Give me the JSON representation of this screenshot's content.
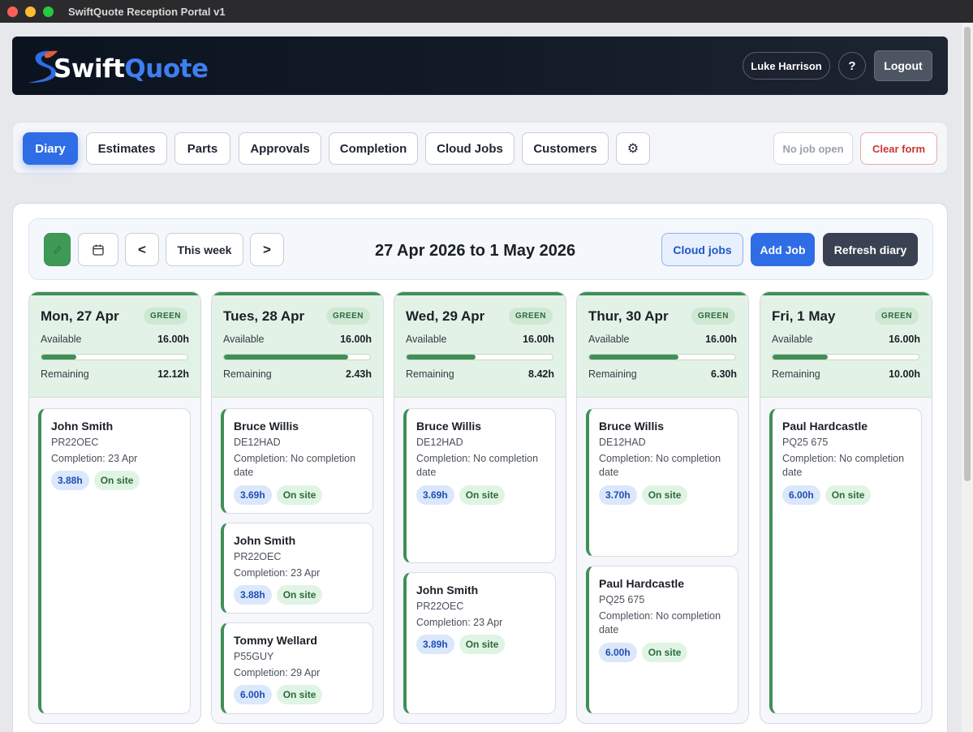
{
  "window": {
    "title": "SwiftQuote Reception Portal v1"
  },
  "header": {
    "logo_swift": "Swift",
    "logo_quote": "Quote",
    "user_name": "Luke Harrison",
    "help_label": "?",
    "logout_label": "Logout"
  },
  "nav": {
    "tabs": [
      "Diary",
      "Estimates",
      "Parts",
      "Approvals",
      "Completion",
      "Cloud Jobs",
      "Customers"
    ],
    "settings_glyph": "⚙",
    "job_status": "No job open",
    "clear_form": "Clear form"
  },
  "toolbar": {
    "prev": "<",
    "this_week": "This week",
    "next": ">",
    "range_title": "27 Apr 2026 to 1 May 2026",
    "cloud_jobs": "Cloud jobs",
    "add_job": "Add Job",
    "refresh": "Refresh diary"
  },
  "days": [
    {
      "name": "Mon, 27 Apr",
      "badge": "GREEN",
      "available_label": "Available",
      "available": "16.00h",
      "remaining_label": "Remaining",
      "remaining": "12.12h",
      "used_fraction": 0.24,
      "jobs": [
        {
          "name": "John Smith",
          "reg": "PR22OEC",
          "completion": "Completion: 23 Apr",
          "hours": "3.88h",
          "status": "On site"
        }
      ]
    },
    {
      "name": "Tues, 28 Apr",
      "badge": "GREEN",
      "available_label": "Available",
      "available": "16.00h",
      "remaining_label": "Remaining",
      "remaining": "2.43h",
      "used_fraction": 0.85,
      "jobs": [
        {
          "name": "Bruce Willis",
          "reg": "DE12HAD",
          "completion": "Completion: No completion date",
          "hours": "3.69h",
          "status": "On site"
        },
        {
          "name": "John Smith",
          "reg": "PR22OEC",
          "completion": "Completion: 23 Apr",
          "hours": "3.88h",
          "status": "On site"
        },
        {
          "name": "Tommy Wellard",
          "reg": "P55GUY",
          "completion": "Completion: 29 Apr",
          "hours": "6.00h",
          "status": "On site"
        }
      ]
    },
    {
      "name": "Wed, 29 Apr",
      "badge": "GREEN",
      "available_label": "Available",
      "available": "16.00h",
      "remaining_label": "Remaining",
      "remaining": "8.42h",
      "used_fraction": 0.47,
      "jobs": [
        {
          "name": "Bruce Willis",
          "reg": "DE12HAD",
          "completion": "Completion: No completion date",
          "hours": "3.69h",
          "status": "On site"
        },
        {
          "name": "John Smith",
          "reg": "PR22OEC",
          "completion": "Completion: 23 Apr",
          "hours": "3.89h",
          "status": "On site"
        }
      ]
    },
    {
      "name": "Thur, 30 Apr",
      "badge": "GREEN",
      "available_label": "Available",
      "available": "16.00h",
      "remaining_label": "Remaining",
      "remaining": "6.30h",
      "used_fraction": 0.61,
      "jobs": [
        {
          "name": "Bruce Willis",
          "reg": "DE12HAD",
          "completion": "Completion: No completion date",
          "hours": "3.70h",
          "status": "On site"
        },
        {
          "name": "Paul Hardcastle",
          "reg": "PQ25 675",
          "completion": "Completion: No completion date",
          "hours": "6.00h",
          "status": "On site"
        }
      ]
    },
    {
      "name": "Fri, 1 May",
      "badge": "GREEN",
      "available_label": "Available",
      "available": "16.00h",
      "remaining_label": "Remaining",
      "remaining": "10.00h",
      "used_fraction": 0.38,
      "jobs": [
        {
          "name": "Paul Hardcastle",
          "reg": "PQ25 675",
          "completion": "Completion: No completion date",
          "hours": "6.00h",
          "status": "On site"
        }
      ]
    }
  ],
  "colors": {
    "accent": "#2f6de6",
    "day_green": "#3f8f57",
    "header_dark": "#0c1320"
  }
}
